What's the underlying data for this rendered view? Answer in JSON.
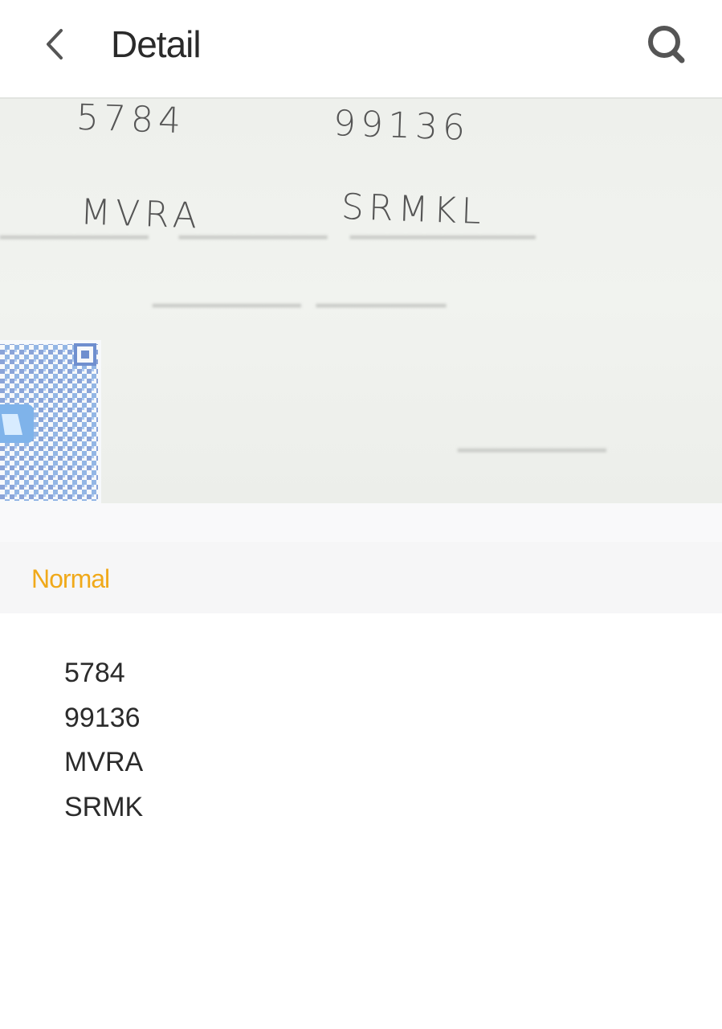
{
  "header": {
    "title": "Detail",
    "back_icon": "chevron-left-icon",
    "search_icon": "search-icon"
  },
  "photo": {
    "handwriting": [
      "5784",
      "99136",
      "MVRA",
      "SRMKL"
    ],
    "qr_icon": "qr-code-icon"
  },
  "section": {
    "label": "Normal",
    "color": "#f0a91a"
  },
  "result": {
    "lines": [
      "5784",
      "99136",
      "MVRA",
      "SRMK"
    ]
  }
}
